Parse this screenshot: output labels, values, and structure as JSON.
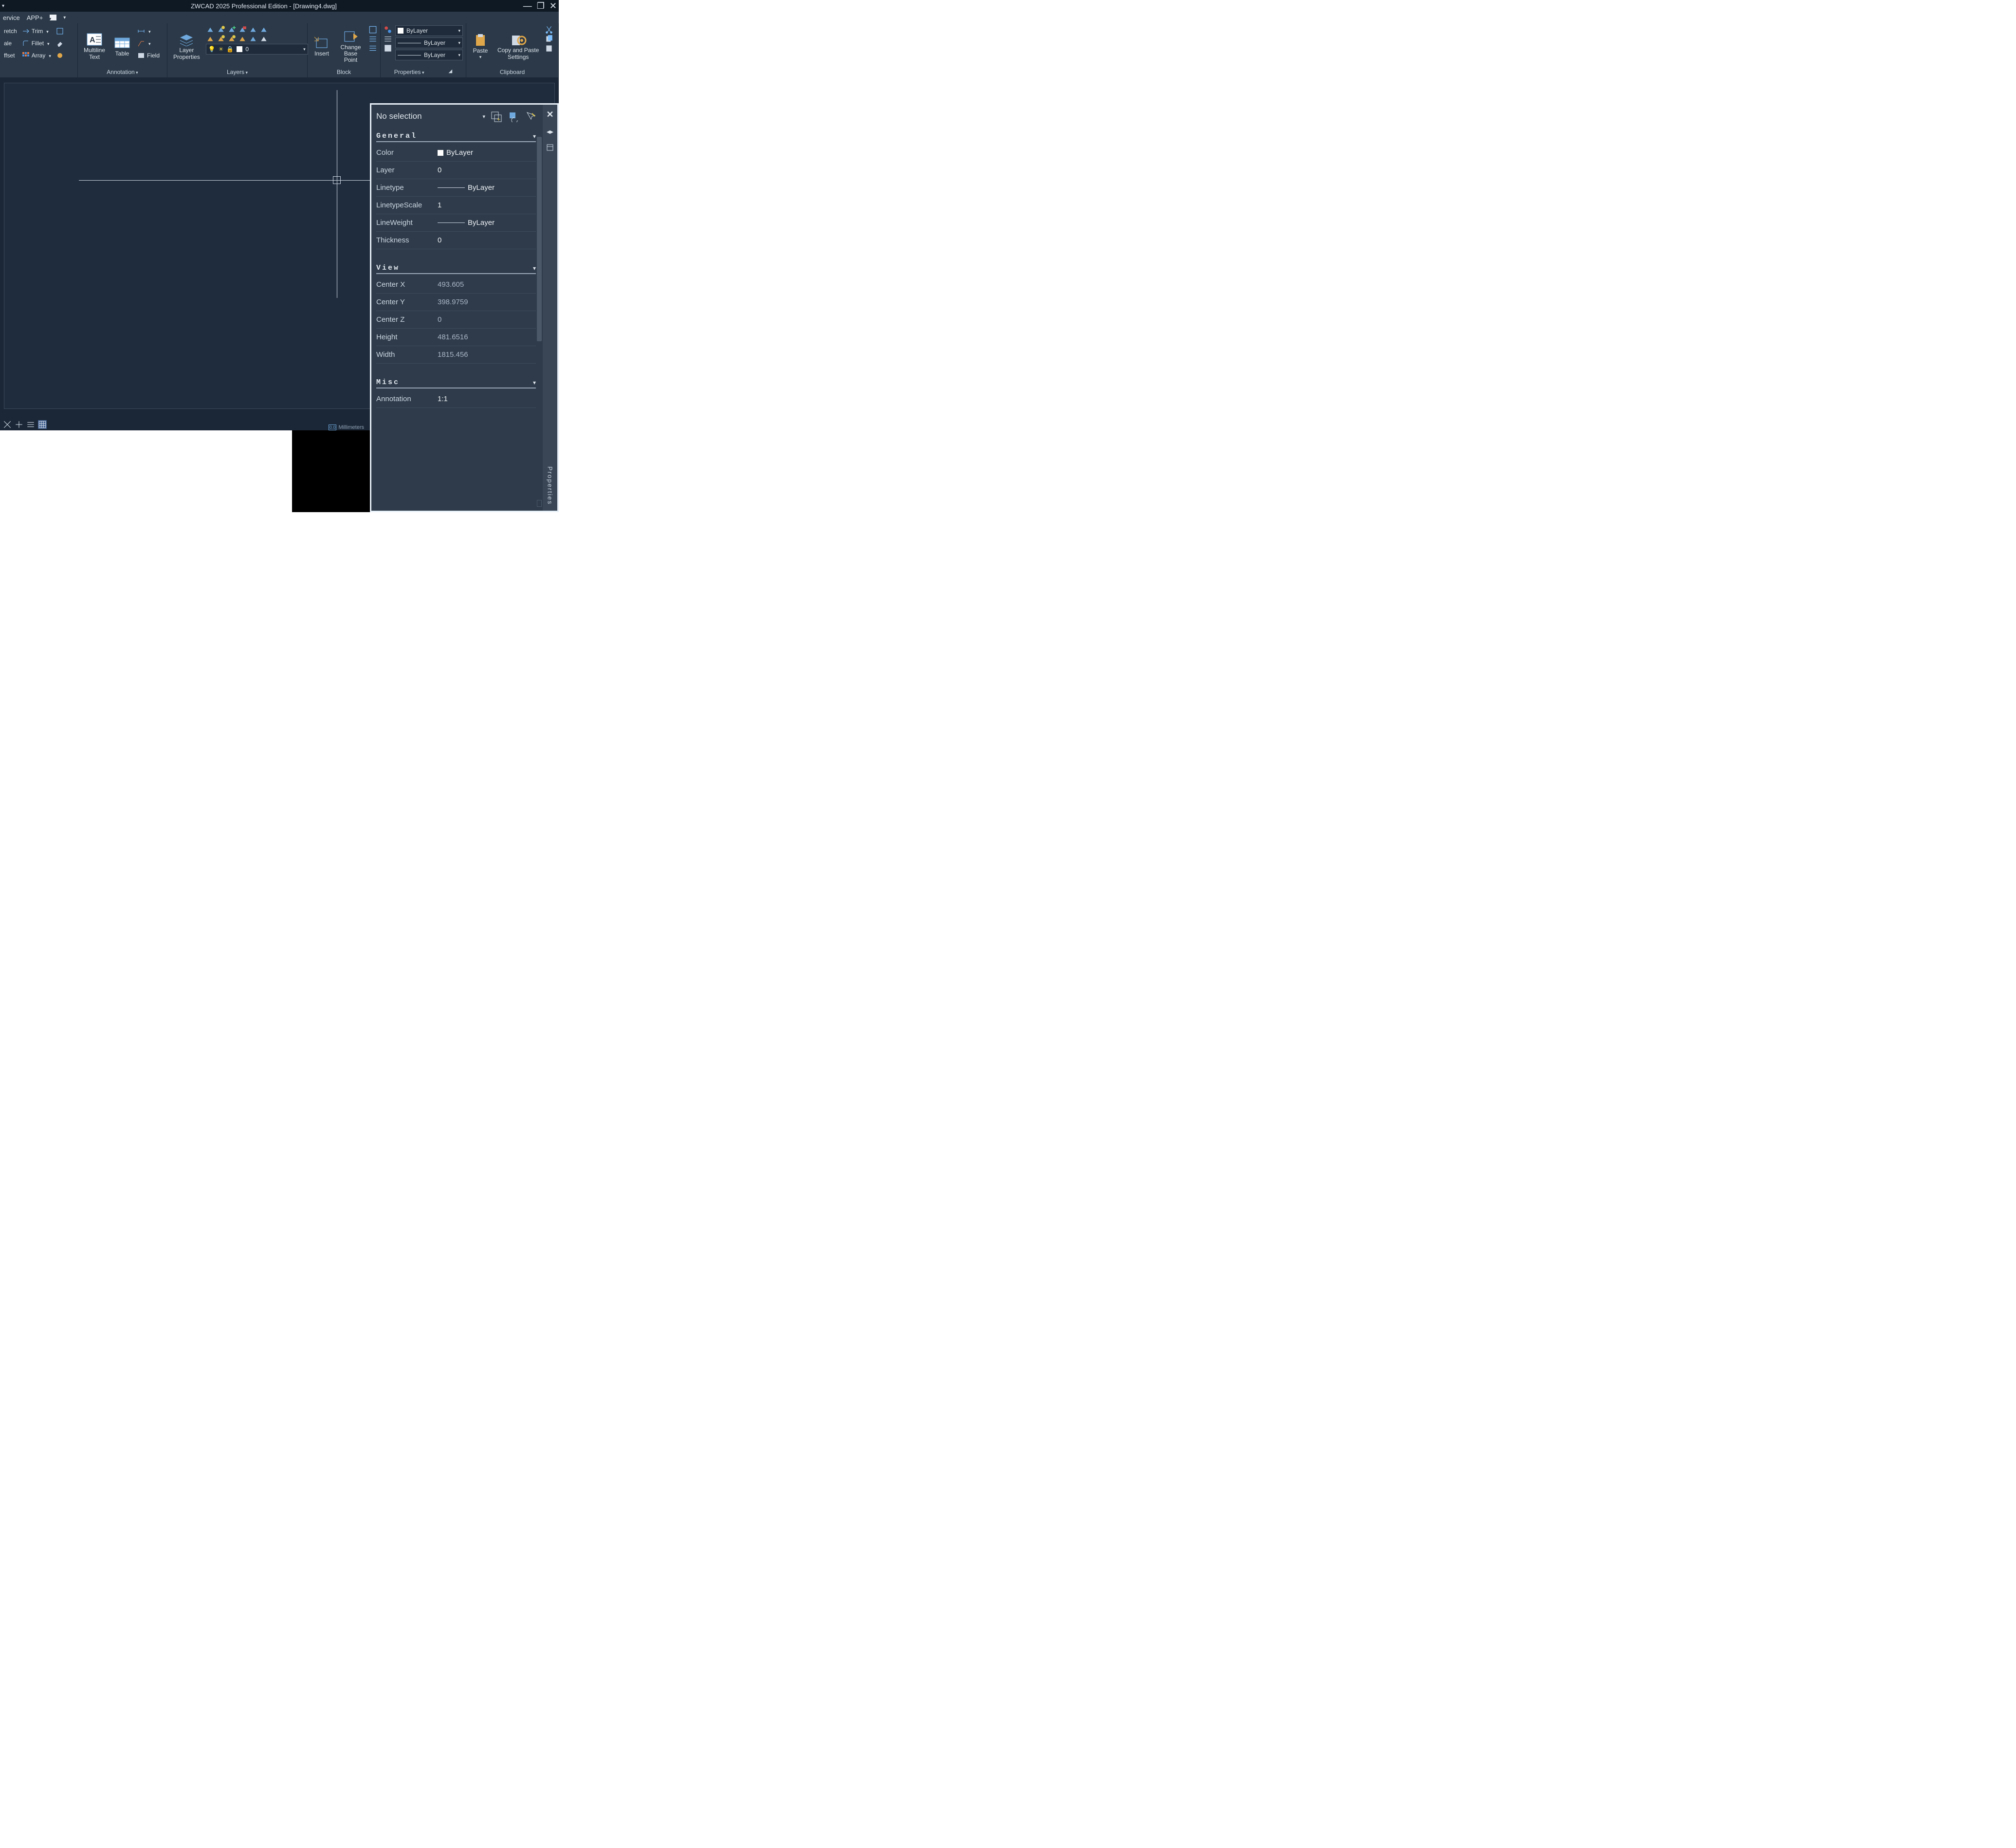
{
  "title": "ZWCAD 2025 Professional Edition - [Drawing4.dwg]",
  "menubar": {
    "items": [
      "ervice",
      "APP+"
    ]
  },
  "ribbon": {
    "modify": {
      "stretch": "retch",
      "trim": "Trim",
      "scale": "ale",
      "fillet": "Fillet",
      "offset": "ffset",
      "array": "Array"
    },
    "annotation": {
      "multiline": "Multiline\nText",
      "table": "Table",
      "field": "Field",
      "label": "Annotation"
    },
    "layers": {
      "layerprops": "Layer\nProperties",
      "current": "0",
      "label": "Layers"
    },
    "block": {
      "insert": "Insert",
      "change": "Change\nBase Point",
      "label": "Block"
    },
    "properties": {
      "color": "ByLayer",
      "lineweight": "ByLayer",
      "linetype": "ByLayer",
      "label": "Properties"
    },
    "clipboard": {
      "paste": "Paste",
      "copy": "Copy and Paste\nSettings",
      "label": "Clipboard"
    }
  },
  "docbar": {
    "min": "_",
    "restore": "❐",
    "close": "×"
  },
  "units": {
    "badge": "0.0",
    "label": "Millimeters"
  },
  "palette": {
    "selection": "No selection",
    "sidelabel": "Properties",
    "sections": {
      "general": {
        "name": "General",
        "rows": {
          "color": {
            "lbl": "Color",
            "val": "ByLayer"
          },
          "layer": {
            "lbl": "Layer",
            "val": "0"
          },
          "linetype": {
            "lbl": "Linetype",
            "val": "ByLayer"
          },
          "linetypescale": {
            "lbl": "LinetypeScale",
            "val": "1"
          },
          "lineweight": {
            "lbl": "LineWeight",
            "val": "ByLayer"
          },
          "thickness": {
            "lbl": "Thickness",
            "val": "0"
          }
        }
      },
      "view": {
        "name": "View",
        "rows": {
          "cx": {
            "lbl": "Center X",
            "val": "493.605"
          },
          "cy": {
            "lbl": "Center Y",
            "val": "398.9759"
          },
          "cz": {
            "lbl": "Center Z",
            "val": "0"
          },
          "h": {
            "lbl": "Height",
            "val": "481.6516"
          },
          "w": {
            "lbl": "Width",
            "val": "1815.456"
          }
        }
      },
      "misc": {
        "name": "Misc",
        "rows": {
          "anno": {
            "lbl": "Annotation",
            "val": "1:1"
          }
        }
      }
    }
  }
}
